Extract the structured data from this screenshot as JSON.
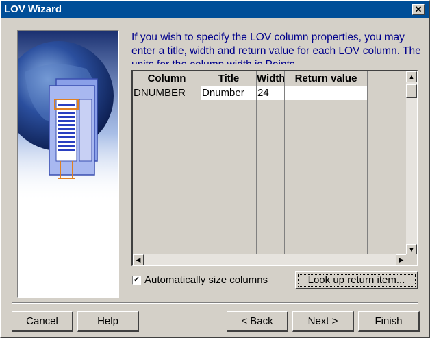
{
  "window": {
    "title": "LOV Wizard",
    "close_glyph": "✕"
  },
  "description": "If you wish to specify the LOV column properties, you may enter a title, width and return value for each LOV column. The units for the column width is Points.",
  "grid": {
    "columns": [
      "Column",
      "Title",
      "Width",
      "Return value"
    ],
    "rows": [
      {
        "column": "DNUMBER",
        "title": "Dnumber",
        "width": "24",
        "return_value": ""
      }
    ],
    "scroll": {
      "up": "▲",
      "down": "▼",
      "left": "◀",
      "right": "▶"
    }
  },
  "options": {
    "auto_size": {
      "label": "Automatically size columns",
      "checked": true,
      "glyph": "✓"
    }
  },
  "buttons": {
    "lookup": "Look up return item...",
    "cancel": "Cancel",
    "help": "Help",
    "back": "< Back",
    "next": "Next >",
    "finish": "Finish"
  },
  "colors": {
    "titlebar": "#004e98",
    "description_text": "#00008b",
    "face": "#d4d0c8"
  }
}
